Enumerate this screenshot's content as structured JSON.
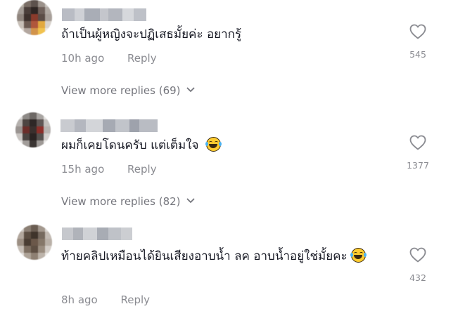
{
  "comments": [
    {
      "text": "ถ้าเป็นผู้หญิงจะปฏิเสธมั้ยค่ะ อยากรู้",
      "time": "10h ago",
      "reply_label": "Reply",
      "likes": "545",
      "view_more": "View more replies (69)"
    },
    {
      "text": "ผมก็เคยโดนครับ แต่เต็มใจ",
      "emoji": "face-with-tears-of-joy",
      "time": "15h ago",
      "reply_label": "Reply",
      "likes": "1377",
      "view_more": "View more replies (82)"
    },
    {
      "text": "ท้ายคลิปเหมือนได้ยินเสียงอาบน้ำ ลค อาบน้ำอยู่ใช่มั้ยคะ",
      "emoji": "face-with-tears-of-joy",
      "time": "8h ago",
      "reply_label": "Reply",
      "likes": "432"
    }
  ],
  "colors": {
    "text": "#161823",
    "muted": "#8a8b91",
    "view_more": "#75767d",
    "heart_stroke": "#8a8b91"
  },
  "icons": [
    "heart-outline-icon",
    "chevron-down-icon",
    "face-with-tears-of-joy-emoji"
  ]
}
